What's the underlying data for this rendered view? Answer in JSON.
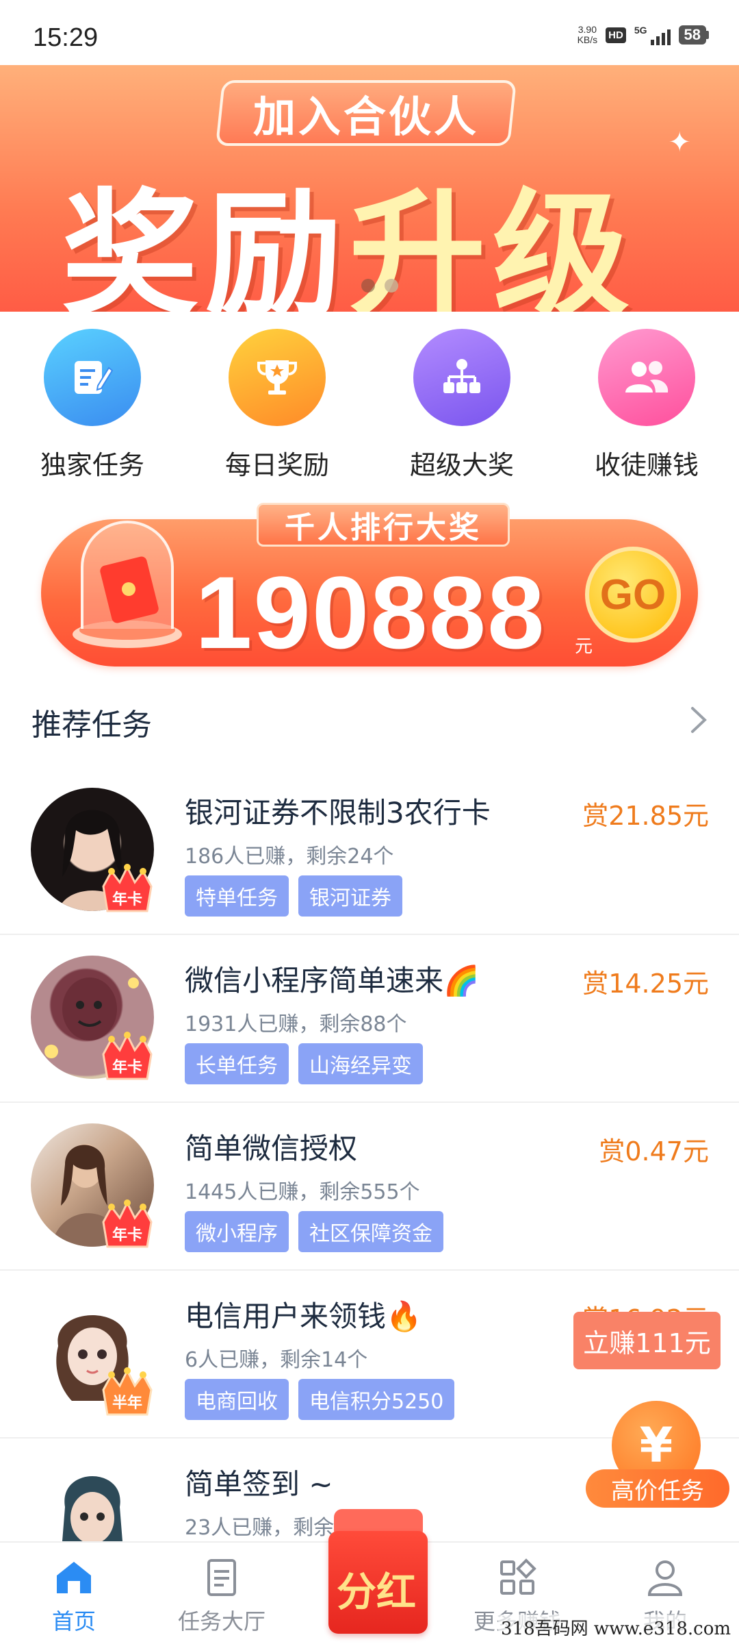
{
  "status_bar": {
    "time": "15:29",
    "net_speed_value": "3.90",
    "net_speed_unit": "KB/s",
    "hd_label": "HD",
    "network_type": "5G",
    "battery": "58"
  },
  "banner": {
    "tag_text": "加入合伙人",
    "headline_white": "奖励",
    "headline_gold": "升级",
    "page_count": 2,
    "active_page": 2
  },
  "quick_menu": {
    "items": [
      {
        "label": "独家任务",
        "icon": "edit-note-icon",
        "color": "#3a8cf0"
      },
      {
        "label": "每日奖励",
        "icon": "trophy-icon",
        "color": "#ff8a28"
      },
      {
        "label": "超级大奖",
        "icon": "hierarchy-icon",
        "color": "#7a55ee"
      },
      {
        "label": "收徒赚钱",
        "icon": "users-icon",
        "color": "#ff4f9c"
      }
    ]
  },
  "rank_banner": {
    "title": "千人排行大奖",
    "amount": "190888",
    "unit": "元",
    "go_label": "GO"
  },
  "section": {
    "title": "推荐任务"
  },
  "tasks": [
    {
      "title": "银河证券不限制3农行卡",
      "reward": "赏21.85元",
      "stats": "186人已赚，剩余24个",
      "tags": [
        "特单任务",
        "银河证券"
      ],
      "badge": "年卡"
    },
    {
      "title": "微信小程序简单速来🌈",
      "reward": "赏14.25元",
      "stats": "1931人已赚，剩余88个",
      "tags": [
        "长单任务",
        "山海经异变"
      ],
      "badge": "年卡"
    },
    {
      "title": "简单微信授权",
      "reward": "赏0.47元",
      "stats": "1445人已赚，剩余555个",
      "tags": [
        "微小程序",
        "社区保障资金"
      ],
      "badge": "年卡"
    },
    {
      "title": "电信用户来领钱🔥",
      "reward": "赏16.92元",
      "stats": "6人已赚，剩余14个",
      "tags": [
        "电商回收",
        "电信积分5250"
      ],
      "badge": "半年"
    },
    {
      "title": "简单签到 ~",
      "reward": "",
      "stats": "23人已赚，剩余2",
      "tags": [],
      "badge": ""
    }
  ],
  "floating": {
    "earn_now": "立赚111元",
    "high_price": "高价任务",
    "high_price_symbol": "¥"
  },
  "tab_bar": {
    "tabs": [
      {
        "label": "首页",
        "icon": "home-icon",
        "active": true
      },
      {
        "label": "任务大厅",
        "icon": "document-icon",
        "active": false
      },
      {
        "label": "更多赚钱",
        "icon": "apps-icon",
        "active": false
      },
      {
        "label": "我的",
        "icon": "person-icon",
        "active": false
      }
    ],
    "center_label": "分红"
  },
  "watermark": "318吾码网 www.e318.com",
  "colors": {
    "accent_blue": "#2b8cf3",
    "reward_orange": "#ef7b1c",
    "tag_blue": "#8aa3f6",
    "banner_orange": "#ff6a3e"
  }
}
